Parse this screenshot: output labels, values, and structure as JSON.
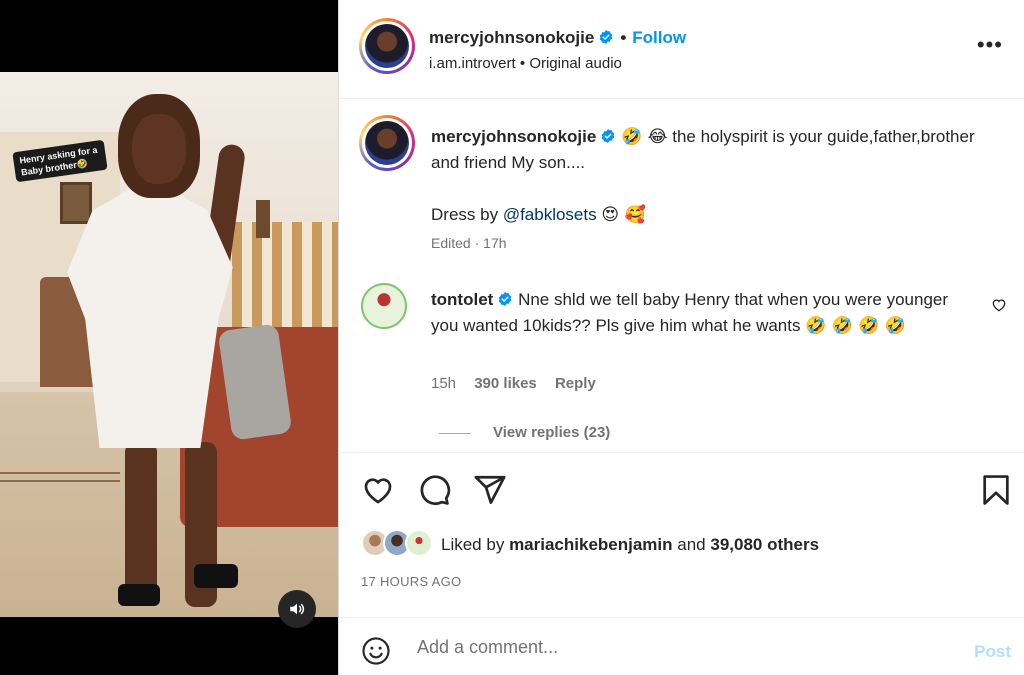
{
  "media": {
    "sticker_text": "Henry asking for a Baby brother🤣",
    "mute_icon": "speaker-icon"
  },
  "header": {
    "username": "mercyjohnsonokojie",
    "separator": "•",
    "follow_label": "Follow",
    "audio_user": "i.am.introvert",
    "audio_separator": "•",
    "audio_label": "Original audio",
    "more_icon": "more-options-icon"
  },
  "caption": {
    "username": "mercyjohnsonokojie",
    "emojis_lead": "🤣 😂",
    "text": "the holyspirit is your guide,father,brother and friend My son....",
    "dress_by": "Dress by",
    "mention": "@fabklosets",
    "emojis_trail": "😍 🥰",
    "edited": "Edited",
    "meta_sep": "·",
    "time": "17h"
  },
  "comment": {
    "username": "tontolet",
    "text": "Nne shld we tell baby Henry that when you were younger you wanted 10kids?? Pls give him what he wants",
    "emojis": "🤣 🤣 🤣 🤣",
    "time": "15h",
    "likes": "390 likes",
    "reply_label": "Reply",
    "view_replies": "View replies (23)"
  },
  "actions": {
    "like_icon": "heart-icon",
    "comment_icon": "comment-icon",
    "share_icon": "share-icon",
    "save_icon": "bookmark-icon"
  },
  "likes": {
    "prefix": "Liked by",
    "user": "mariachikebenjamin",
    "and": "and",
    "others": "39,080 others"
  },
  "time_ago": "17 HOURS AGO",
  "add_comment": {
    "placeholder": "Add a comment...",
    "post_label": "Post"
  },
  "colors": {
    "accent": "#0095f6",
    "post_disabled": "#b2dffc",
    "secondary_text": "#737373"
  }
}
